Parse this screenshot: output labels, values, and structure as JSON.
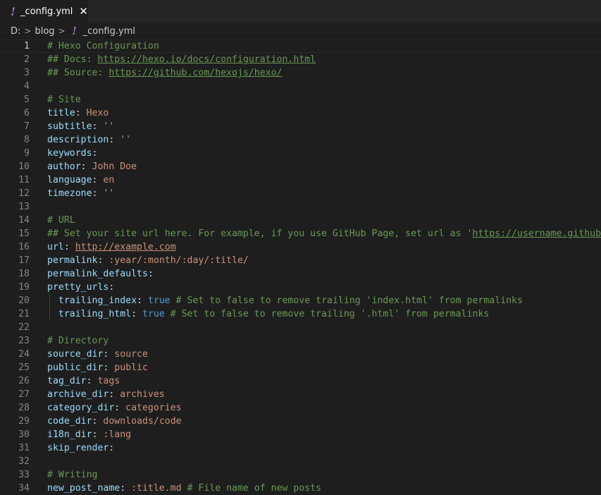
{
  "tab": {
    "icon": "yaml-file-icon",
    "filename": "_config.yml",
    "close_glyph": "✕"
  },
  "breadcrumb": {
    "drive": "D:",
    "folder": "blog",
    "file": "_config.yml"
  },
  "editor": {
    "current_line": 1,
    "lines": [
      {
        "n": "1",
        "segs": [
          {
            "t": "cm",
            "v": "# Hexo Configuration"
          }
        ]
      },
      {
        "n": "2",
        "segs": [
          {
            "t": "cm",
            "v": "## Docs: "
          },
          {
            "t": "link",
            "v": "https://hexo.io/docs/configuration.html"
          }
        ]
      },
      {
        "n": "3",
        "segs": [
          {
            "t": "cm",
            "v": "## Source: "
          },
          {
            "t": "link",
            "v": "https://github.com/hexojs/hexo/"
          }
        ]
      },
      {
        "n": "4",
        "segs": []
      },
      {
        "n": "5",
        "segs": [
          {
            "t": "cm",
            "v": "# Site"
          }
        ]
      },
      {
        "n": "6",
        "segs": [
          {
            "t": "k",
            "v": "title"
          },
          {
            "t": "p",
            "v": ": "
          },
          {
            "t": "v",
            "v": "Hexo"
          }
        ]
      },
      {
        "n": "7",
        "segs": [
          {
            "t": "k",
            "v": "subtitle"
          },
          {
            "t": "p",
            "v": ": "
          },
          {
            "t": "v",
            "v": "''"
          }
        ]
      },
      {
        "n": "8",
        "segs": [
          {
            "t": "k",
            "v": "description"
          },
          {
            "t": "p",
            "v": ": "
          },
          {
            "t": "v",
            "v": "''"
          }
        ]
      },
      {
        "n": "9",
        "segs": [
          {
            "t": "k",
            "v": "keywords"
          },
          {
            "t": "p",
            "v": ":"
          }
        ]
      },
      {
        "n": "10",
        "segs": [
          {
            "t": "k",
            "v": "author"
          },
          {
            "t": "p",
            "v": ": "
          },
          {
            "t": "v",
            "v": "John Doe"
          }
        ]
      },
      {
        "n": "11",
        "segs": [
          {
            "t": "k",
            "v": "language"
          },
          {
            "t": "p",
            "v": ": "
          },
          {
            "t": "v",
            "v": "en"
          }
        ]
      },
      {
        "n": "12",
        "segs": [
          {
            "t": "k",
            "v": "timezone"
          },
          {
            "t": "p",
            "v": ": "
          },
          {
            "t": "v",
            "v": "''"
          }
        ]
      },
      {
        "n": "13",
        "segs": []
      },
      {
        "n": "14",
        "segs": [
          {
            "t": "cm",
            "v": "# URL"
          }
        ]
      },
      {
        "n": "15",
        "segs": [
          {
            "t": "cm",
            "v": "## Set your site url here. For example, if you use GitHub Page, set url as '"
          },
          {
            "t": "link",
            "v": "https://username.github.io/project"
          }
        ]
      },
      {
        "n": "16",
        "segs": [
          {
            "t": "k",
            "v": "url"
          },
          {
            "t": "p",
            "v": ": "
          },
          {
            "t": "urlv",
            "v": "http://example.com"
          }
        ]
      },
      {
        "n": "17",
        "segs": [
          {
            "t": "k",
            "v": "permalink"
          },
          {
            "t": "p",
            "v": ": "
          },
          {
            "t": "v",
            "v": ":year/:month/:day/:title/"
          }
        ]
      },
      {
        "n": "18",
        "segs": [
          {
            "t": "k",
            "v": "permalink_defaults"
          },
          {
            "t": "p",
            "v": ":"
          }
        ]
      },
      {
        "n": "19",
        "segs": [
          {
            "t": "k",
            "v": "pretty_urls"
          },
          {
            "t": "p",
            "v": ":"
          }
        ]
      },
      {
        "n": "20",
        "guide": true,
        "segs": [
          {
            "t": "p",
            "v": "  "
          },
          {
            "t": "k",
            "v": "trailing_index"
          },
          {
            "t": "p",
            "v": ": "
          },
          {
            "t": "b",
            "v": "true"
          },
          {
            "t": "cm",
            "v": " # Set to false to remove trailing 'index.html' from permalinks"
          }
        ]
      },
      {
        "n": "21",
        "guide": true,
        "segs": [
          {
            "t": "p",
            "v": "  "
          },
          {
            "t": "k",
            "v": "trailing_html"
          },
          {
            "t": "p",
            "v": ": "
          },
          {
            "t": "b",
            "v": "true"
          },
          {
            "t": "cm",
            "v": " # Set to false to remove trailing '.html' from permalinks"
          }
        ]
      },
      {
        "n": "22",
        "segs": []
      },
      {
        "n": "23",
        "segs": [
          {
            "t": "cm",
            "v": "# Directory"
          }
        ]
      },
      {
        "n": "24",
        "segs": [
          {
            "t": "k",
            "v": "source_dir"
          },
          {
            "t": "p",
            "v": ": "
          },
          {
            "t": "v",
            "v": "source"
          }
        ]
      },
      {
        "n": "25",
        "segs": [
          {
            "t": "k",
            "v": "public_dir"
          },
          {
            "t": "p",
            "v": ": "
          },
          {
            "t": "v",
            "v": "public"
          }
        ]
      },
      {
        "n": "26",
        "segs": [
          {
            "t": "k",
            "v": "tag_dir"
          },
          {
            "t": "p",
            "v": ": "
          },
          {
            "t": "v",
            "v": "tags"
          }
        ]
      },
      {
        "n": "27",
        "segs": [
          {
            "t": "k",
            "v": "archive_dir"
          },
          {
            "t": "p",
            "v": ": "
          },
          {
            "t": "v",
            "v": "archives"
          }
        ]
      },
      {
        "n": "28",
        "segs": [
          {
            "t": "k",
            "v": "category_dir"
          },
          {
            "t": "p",
            "v": ": "
          },
          {
            "t": "v",
            "v": "categories"
          }
        ]
      },
      {
        "n": "29",
        "segs": [
          {
            "t": "k",
            "v": "code_dir"
          },
          {
            "t": "p",
            "v": ": "
          },
          {
            "t": "v",
            "v": "downloads/code"
          }
        ]
      },
      {
        "n": "30",
        "segs": [
          {
            "t": "k",
            "v": "i18n_dir"
          },
          {
            "t": "p",
            "v": ": "
          },
          {
            "t": "v",
            "v": ":lang"
          }
        ]
      },
      {
        "n": "31",
        "segs": [
          {
            "t": "k",
            "v": "skip_render"
          },
          {
            "t": "p",
            "v": ":"
          }
        ]
      },
      {
        "n": "32",
        "segs": []
      },
      {
        "n": "33",
        "segs": [
          {
            "t": "cm",
            "v": "# Writing"
          }
        ]
      },
      {
        "n": "34",
        "segs": [
          {
            "t": "k",
            "v": "new_post_name"
          },
          {
            "t": "p",
            "v": ": "
          },
          {
            "t": "v",
            "v": ":title.md"
          },
          {
            "t": "cm",
            "v": " # File name of new posts"
          }
        ]
      }
    ]
  },
  "colors": {
    "background": "#1e1e1e",
    "tabbar": "#252526",
    "comment": "#6a9955",
    "key": "#9cdcfe",
    "string": "#ce9178",
    "boolean": "#569cd6",
    "yaml_icon": "#a074c4"
  }
}
